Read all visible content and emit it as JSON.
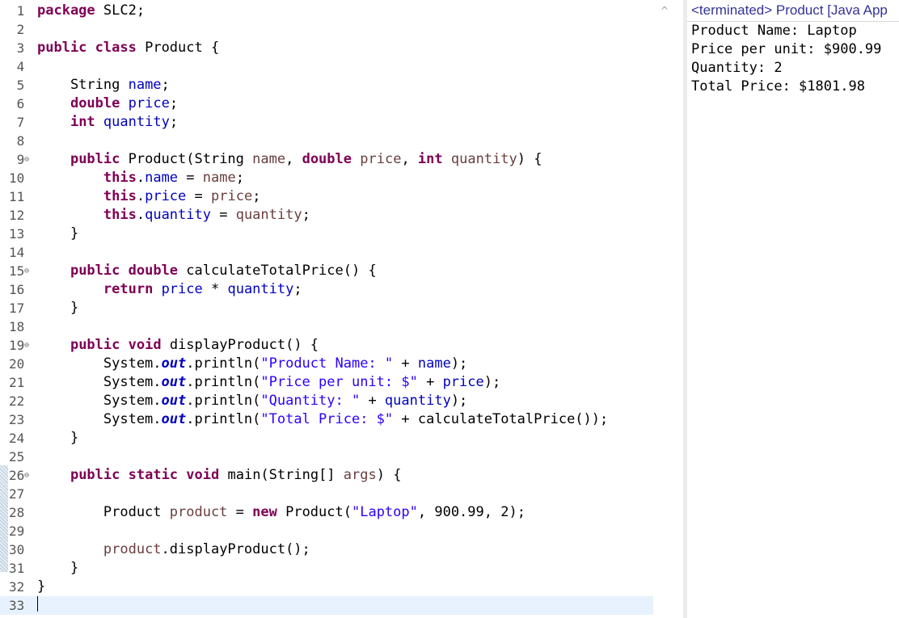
{
  "editor": {
    "lines": [
      {
        "num": " 1",
        "tokens": [
          {
            "t": "package",
            "c": "kw"
          },
          {
            "t": " SLC2;"
          }
        ]
      },
      {
        "num": " 2",
        "tokens": []
      },
      {
        "num": " 3",
        "tokens": [
          {
            "t": "public",
            "c": "kw"
          },
          {
            "t": " "
          },
          {
            "t": "class",
            "c": "kw"
          },
          {
            "t": " Product {"
          }
        ]
      },
      {
        "num": " 4",
        "tokens": []
      },
      {
        "num": " 5",
        "tokens": [
          {
            "t": "    String "
          },
          {
            "t": "name",
            "c": "fld"
          },
          {
            "t": ";"
          }
        ]
      },
      {
        "num": " 6",
        "tokens": [
          {
            "t": "    "
          },
          {
            "t": "double",
            "c": "kw"
          },
          {
            "t": " "
          },
          {
            "t": "price",
            "c": "fld"
          },
          {
            "t": ";"
          }
        ]
      },
      {
        "num": " 7",
        "tokens": [
          {
            "t": "    "
          },
          {
            "t": "int",
            "c": "kw"
          },
          {
            "t": " "
          },
          {
            "t": "quantity",
            "c": "fld"
          },
          {
            "t": ";"
          }
        ]
      },
      {
        "num": " 8",
        "tokens": []
      },
      {
        "num": " 9",
        "fold": true,
        "tokens": [
          {
            "t": "    "
          },
          {
            "t": "public",
            "c": "kw"
          },
          {
            "t": " Product(String "
          },
          {
            "t": "name",
            "c": "param"
          },
          {
            "t": ", "
          },
          {
            "t": "double",
            "c": "kw"
          },
          {
            "t": " "
          },
          {
            "t": "price",
            "c": "param"
          },
          {
            "t": ", "
          },
          {
            "t": "int",
            "c": "kw"
          },
          {
            "t": " "
          },
          {
            "t": "quantity",
            "c": "param"
          },
          {
            "t": ") {"
          }
        ]
      },
      {
        "num": "10",
        "tokens": [
          {
            "t": "        "
          },
          {
            "t": "this",
            "c": "kw"
          },
          {
            "t": "."
          },
          {
            "t": "name",
            "c": "fld"
          },
          {
            "t": " = "
          },
          {
            "t": "name",
            "c": "param"
          },
          {
            "t": ";"
          }
        ]
      },
      {
        "num": "11",
        "tokens": [
          {
            "t": "        "
          },
          {
            "t": "this",
            "c": "kw"
          },
          {
            "t": "."
          },
          {
            "t": "price",
            "c": "fld"
          },
          {
            "t": " = "
          },
          {
            "t": "price",
            "c": "param"
          },
          {
            "t": ";"
          }
        ]
      },
      {
        "num": "12",
        "tokens": [
          {
            "t": "        "
          },
          {
            "t": "this",
            "c": "kw"
          },
          {
            "t": "."
          },
          {
            "t": "quantity",
            "c": "fld"
          },
          {
            "t": " = "
          },
          {
            "t": "quantity",
            "c": "param"
          },
          {
            "t": ";"
          }
        ]
      },
      {
        "num": "13",
        "tokens": [
          {
            "t": "    }"
          }
        ]
      },
      {
        "num": "14",
        "tokens": []
      },
      {
        "num": "15",
        "fold": true,
        "tokens": [
          {
            "t": "    "
          },
          {
            "t": "public",
            "c": "kw"
          },
          {
            "t": " "
          },
          {
            "t": "double",
            "c": "kw"
          },
          {
            "t": " calculateTotalPrice() {"
          }
        ]
      },
      {
        "num": "16",
        "tokens": [
          {
            "t": "        "
          },
          {
            "t": "return",
            "c": "kw"
          },
          {
            "t": " "
          },
          {
            "t": "price",
            "c": "fld"
          },
          {
            "t": " * "
          },
          {
            "t": "quantity",
            "c": "fld"
          },
          {
            "t": ";"
          }
        ]
      },
      {
        "num": "17",
        "tokens": [
          {
            "t": "    }"
          }
        ]
      },
      {
        "num": "18",
        "tokens": []
      },
      {
        "num": "19",
        "fold": true,
        "tokens": [
          {
            "t": "    "
          },
          {
            "t": "public",
            "c": "kw"
          },
          {
            "t": " "
          },
          {
            "t": "void",
            "c": "kw"
          },
          {
            "t": " displayProduct() {"
          }
        ]
      },
      {
        "num": "20",
        "tokens": [
          {
            "t": "        System."
          },
          {
            "t": "out",
            "c": "sfld"
          },
          {
            "t": ".println("
          },
          {
            "t": "\"Product Name: \"",
            "c": "str"
          },
          {
            "t": " + "
          },
          {
            "t": "name",
            "c": "fld"
          },
          {
            "t": ");"
          }
        ]
      },
      {
        "num": "21",
        "tokens": [
          {
            "t": "        System."
          },
          {
            "t": "out",
            "c": "sfld"
          },
          {
            "t": ".println("
          },
          {
            "t": "\"Price per unit: $\"",
            "c": "str"
          },
          {
            "t": " + "
          },
          {
            "t": "price",
            "c": "fld"
          },
          {
            "t": ");"
          }
        ]
      },
      {
        "num": "22",
        "tokens": [
          {
            "t": "        System."
          },
          {
            "t": "out",
            "c": "sfld"
          },
          {
            "t": ".println("
          },
          {
            "t": "\"Quantity: \"",
            "c": "str"
          },
          {
            "t": " + "
          },
          {
            "t": "quantity",
            "c": "fld"
          },
          {
            "t": ");"
          }
        ]
      },
      {
        "num": "23",
        "tokens": [
          {
            "t": "        System."
          },
          {
            "t": "out",
            "c": "sfld"
          },
          {
            "t": ".println("
          },
          {
            "t": "\"Total Price: $\"",
            "c": "str"
          },
          {
            "t": " + calculateTotalPrice());"
          }
        ]
      },
      {
        "num": "24",
        "tokens": [
          {
            "t": "    }"
          }
        ]
      },
      {
        "num": "25",
        "tokens": []
      },
      {
        "num": "26",
        "fold": true,
        "tokens": [
          {
            "t": "    "
          },
          {
            "t": "public",
            "c": "kw"
          },
          {
            "t": " "
          },
          {
            "t": "static",
            "c": "kw"
          },
          {
            "t": " "
          },
          {
            "t": "void",
            "c": "kw"
          },
          {
            "t": " main(String[] "
          },
          {
            "t": "args",
            "c": "param"
          },
          {
            "t": ") {"
          }
        ]
      },
      {
        "num": "27",
        "tokens": []
      },
      {
        "num": "28",
        "tokens": [
          {
            "t": "        Product "
          },
          {
            "t": "product",
            "c": "param"
          },
          {
            "t": " = "
          },
          {
            "t": "new",
            "c": "kw"
          },
          {
            "t": " Product("
          },
          {
            "t": "\"Laptop\"",
            "c": "str"
          },
          {
            "t": ", 900.99, 2);"
          }
        ]
      },
      {
        "num": "29",
        "tokens": []
      },
      {
        "num": "30",
        "tokens": [
          {
            "t": "        "
          },
          {
            "t": "product",
            "c": "param"
          },
          {
            "t": ".displayProduct();"
          }
        ]
      },
      {
        "num": "31",
        "tokens": [
          {
            "t": "    }"
          }
        ]
      },
      {
        "num": "32",
        "tokens": [
          {
            "t": "}"
          }
        ]
      },
      {
        "num": "33",
        "current": true,
        "caret": true,
        "tokens": []
      }
    ]
  },
  "scrollbar": {
    "up_arrow": "^"
  },
  "console": {
    "header": "<terminated> Product [Java App",
    "output": [
      "Product Name: Laptop",
      "Price per unit: $900.99",
      "Quantity: 2",
      "Total Price: $1801.98"
    ]
  },
  "colors": {
    "keyword": "#7f0055",
    "field": "#0000c0",
    "string": "#2a00ff",
    "parameter": "#6a3e3e",
    "current_line": "#e8f2fe",
    "console_header": "#333399"
  },
  "icons": {
    "fold": "fold-collapse-icon",
    "scroll_up": "scroll-up-arrow-icon"
  }
}
